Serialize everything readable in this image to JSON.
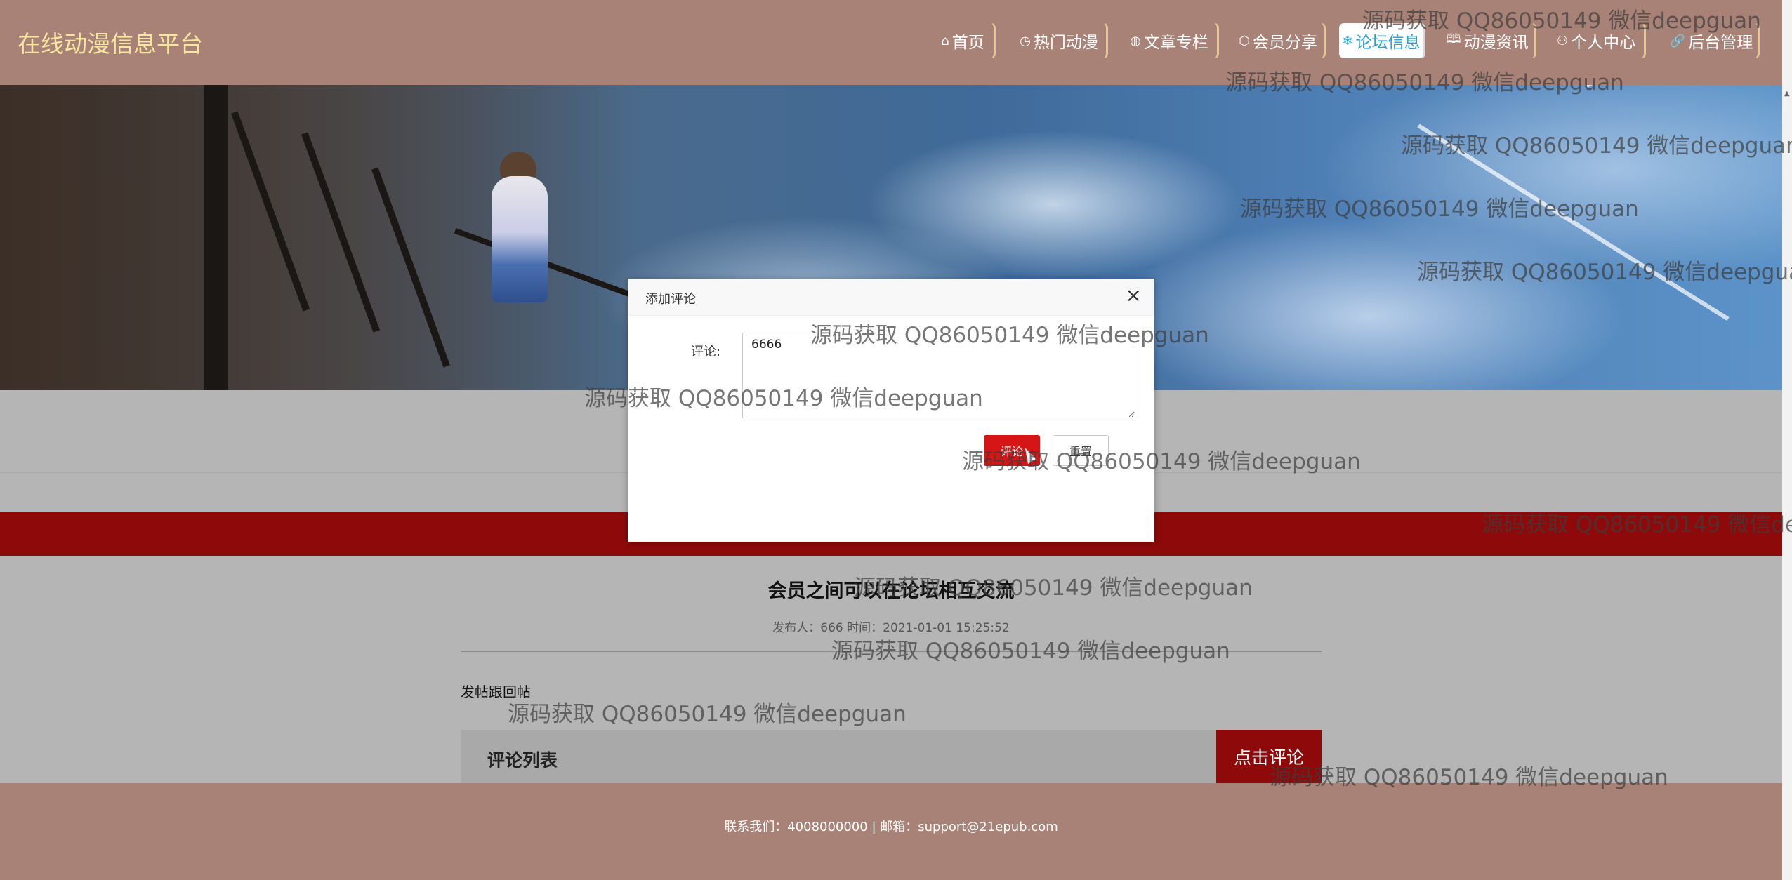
{
  "site": {
    "title": "在线动漫信息平台"
  },
  "nav": [
    {
      "icon": "⌂",
      "label": "首页"
    },
    {
      "icon": "◷",
      "label": "热门动漫"
    },
    {
      "icon": "◍",
      "label": "文章专栏"
    },
    {
      "icon": "⬡",
      "label": "会员分享"
    },
    {
      "icon": "❄",
      "label": "论坛信息",
      "active": true
    },
    {
      "icon": "🕮",
      "label": "动漫资讯"
    },
    {
      "icon": "⚇",
      "label": "个人中心"
    },
    {
      "icon": "🔗",
      "label": "后台管理"
    }
  ],
  "post": {
    "title": "会员之间可以在论坛相互交流",
    "meta": "发布人：666 时间：2021-01-01 15:25:52",
    "reply_label": "发帖跟回帖",
    "comment_list_title": "评论列表",
    "comment_button": "点击评论"
  },
  "footer": {
    "text": "联系我们：4008000000 | 邮箱：support@21epub.com"
  },
  "dialog": {
    "title": "添加评论",
    "close_icon": "×",
    "field_label": "评论:",
    "comment_value": "6666",
    "submit_label": "评论",
    "reset_label": "重置"
  },
  "watermark": {
    "text": "源码获取 QQ86050149 微信deepguan"
  }
}
